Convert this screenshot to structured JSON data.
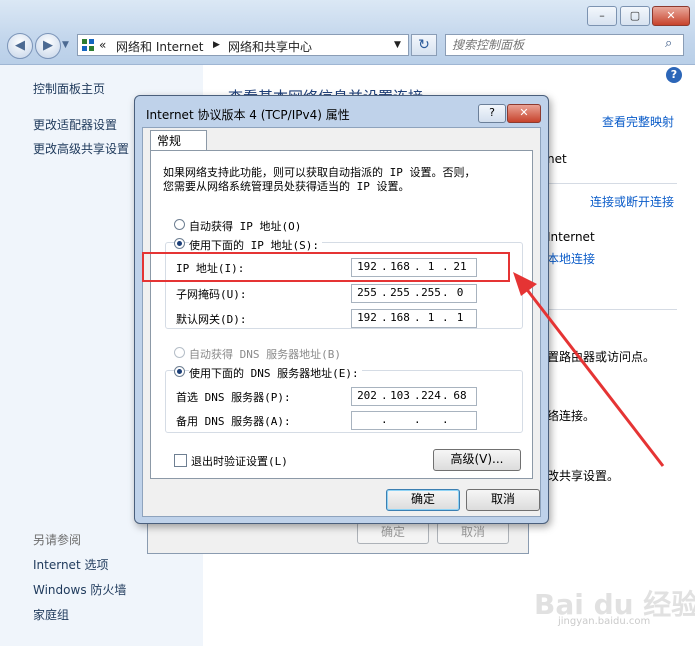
{
  "window": {
    "caption_buttons": [
      "–",
      "▢",
      "✕"
    ],
    "breadcrumb": {
      "prefix": "«",
      "items": [
        "网络和 Internet",
        "网络和共享中心"
      ]
    },
    "search": {
      "placeholder": "搜索控制面板"
    }
  },
  "left_pane": {
    "home": "控制面板主页",
    "links": [
      "更改适配器设置",
      "更改高级共享设置"
    ],
    "see_also_title": "另请参阅",
    "see_also": [
      "Internet 选项",
      "Windows 防火墙",
      "家庭组"
    ]
  },
  "main": {
    "heading_fragment": "查看基本网络信息并设置连接",
    "view_full_map": "查看完整映射",
    "net_fragment": "net",
    "connect_disconnect": "连接或断开连接",
    "internet_label": "Internet",
    "local_connection": "本地连接",
    "text_1": "置路由器或访问点。",
    "text_2": "络连接。",
    "text_3": "改共享设置。"
  },
  "bg_dialog": {
    "ok": "确定",
    "cancel": "取消"
  },
  "dialog": {
    "title": "Internet 协议版本 4 (TCP/IPv4) 属性",
    "help_btn": "?",
    "close_btn": "✕",
    "tab": "常规",
    "desc_line1": "如果网络支持此功能，则可以获取自动指派的 IP 设置。否则，",
    "desc_line2": "您需要从网络系统管理员处获得适当的 IP 设置。",
    "radio_auto_ip": "自动获得 IP 地址(O)",
    "radio_manual_ip": "使用下面的 IP 地址(S):",
    "ip_label": "IP 地址(I):",
    "ip_value": [
      "192",
      "168",
      "1",
      "21"
    ],
    "mask_label": "子网掩码(U):",
    "mask_value": [
      "255",
      "255",
      "255",
      "0"
    ],
    "gateway_label": "默认网关(D):",
    "gateway_value": [
      "192",
      "168",
      "1",
      "1"
    ],
    "radio_auto_dns": "自动获得 DNS 服务器地址(B)",
    "radio_manual_dns": "使用下面的 DNS 服务器地址(E):",
    "dns1_label": "首选 DNS 服务器(P):",
    "dns1_value": [
      "202",
      "103",
      "224",
      "68"
    ],
    "dns2_label": "备用 DNS 服务器(A):",
    "dns2_value": [
      "",
      "",
      "",
      ""
    ],
    "validate_label": "退出时验证设置(L)",
    "validate_checked": false,
    "advanced_btn": "高级(V)...",
    "ok_btn": "确定",
    "cancel_btn": "取消",
    "selected_ip_mode": "manual",
    "selected_dns_mode": "manual"
  },
  "annotation": {
    "highlight_color": "#e53434"
  },
  "watermark": {
    "text": "Bai du 经验",
    "sub": "jingyan.baidu.com"
  }
}
